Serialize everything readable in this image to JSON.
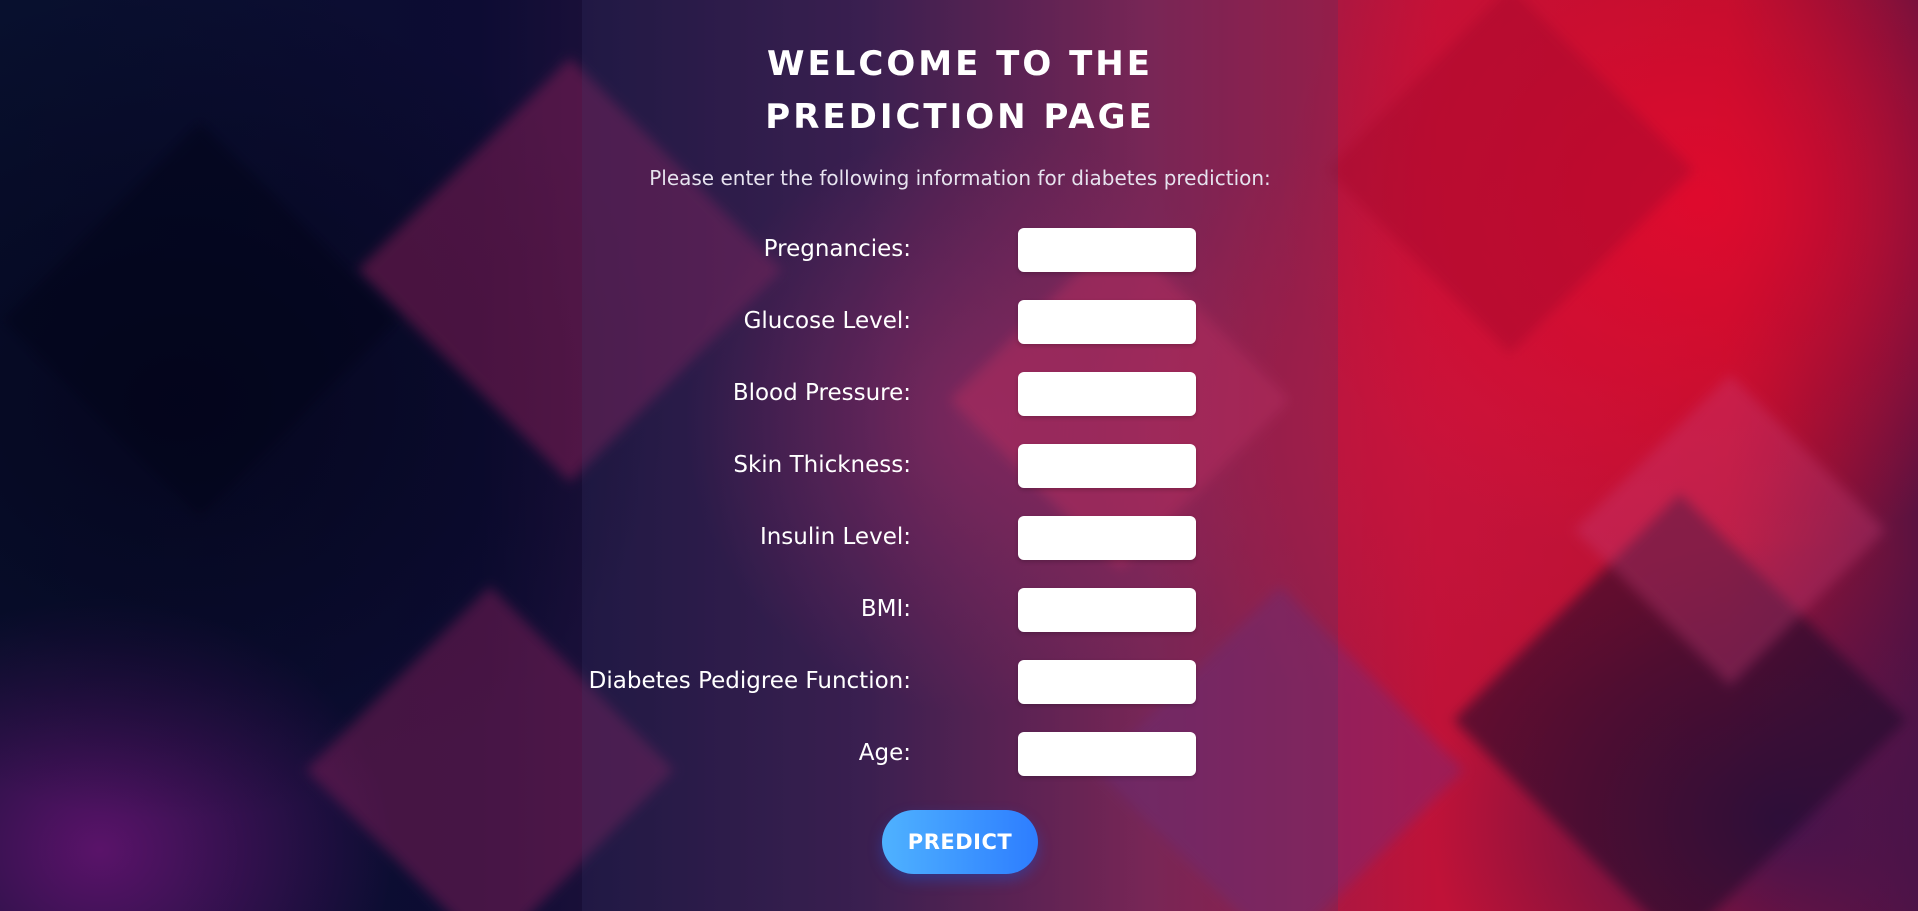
{
  "page": {
    "title": "WELCOME TO THE PREDICTION PAGE",
    "subtitle": "Please enter the following information for diabetes prediction:"
  },
  "form": {
    "fields": [
      {
        "label": "Pregnancies:",
        "value": ""
      },
      {
        "label": "Glucose Level:",
        "value": ""
      },
      {
        "label": "Blood Pressure:",
        "value": ""
      },
      {
        "label": "Skin Thickness:",
        "value": ""
      },
      {
        "label": "Insulin Level:",
        "value": ""
      },
      {
        "label": "BMI:",
        "value": ""
      },
      {
        "label": "Diabetes Pedigree Function:",
        "value": ""
      },
      {
        "label": "Age:",
        "value": ""
      }
    ],
    "submit_label": "PREDICT"
  },
  "colors": {
    "button_gradient_start": "#4fb2ff",
    "button_gradient_end": "#2d7dff",
    "text": "#ffffff"
  }
}
